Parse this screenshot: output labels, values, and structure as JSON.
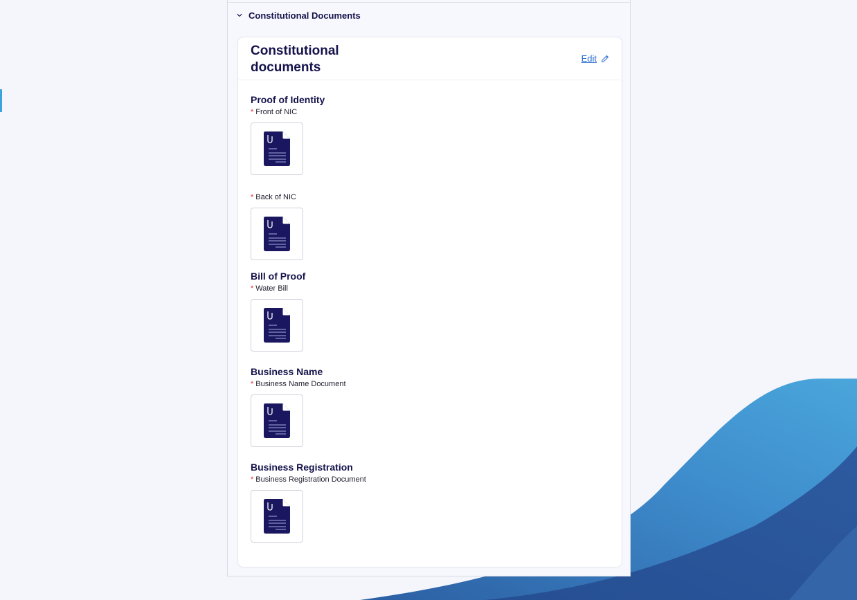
{
  "accordion": {
    "title": "Constitutional Documents"
  },
  "card": {
    "title": "Constitutional documents",
    "edit_label": "Edit"
  },
  "sections": [
    {
      "title": "Proof of Identity",
      "fields": [
        {
          "label": "Front of NIC"
        },
        {
          "label": "Back of NIC"
        }
      ]
    },
    {
      "title": "Bill of Proof",
      "fields": [
        {
          "label": "Water Bill"
        }
      ]
    },
    {
      "title": "Business Name",
      "fields": [
        {
          "label": "Business Name Document"
        }
      ]
    },
    {
      "title": "Business Registration",
      "fields": [
        {
          "label": "Business Registration Document"
        }
      ]
    }
  ],
  "required_marker": "*",
  "icons": {
    "chevron": "chevron-down-icon",
    "edit": "pencil-icon",
    "document": "document-icon"
  },
  "colors": {
    "primary": "#14124a",
    "link": "#2b6fcf",
    "required": "#e0342f",
    "accent": "#3fa3db"
  }
}
